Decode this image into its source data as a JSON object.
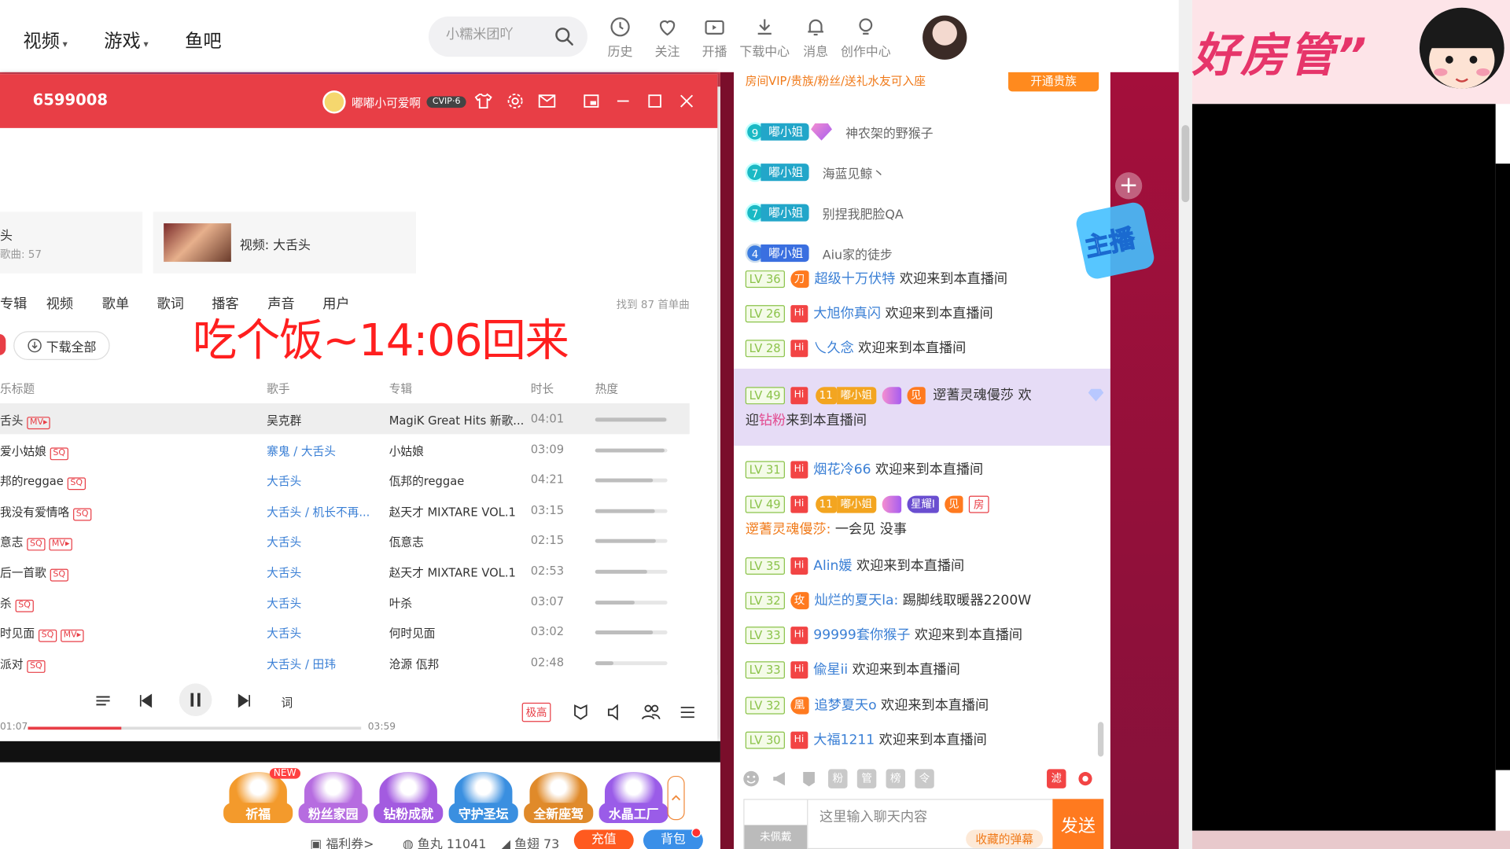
{
  "nav": {
    "links": [
      {
        "label": "视频",
        "caret": "▾"
      },
      {
        "label": "游戏",
        "caret": "▾"
      },
      {
        "label": "鱼吧",
        "caret": ""
      }
    ],
    "search_placeholder": "小糯米团吖",
    "tools": [
      "历史",
      "关注",
      "开播",
      "下载中心",
      "消息",
      "创作中心"
    ]
  },
  "music": {
    "room_id": "6599008",
    "user_name": "嘟嘟小可爱啊",
    "vip": "CVIP·6",
    "card_a": {
      "title": "头",
      "sub": "歌曲: 57"
    },
    "card_b": {
      "title": "视频: 大舌头"
    },
    "tabs": [
      "专辑",
      "视频",
      "歌单",
      "歌词",
      "播客",
      "声音",
      "用户"
    ],
    "found": "找到 87 首单曲",
    "away_msg": "吃个饭~14:06回来",
    "download_all": "下载全部",
    "columns": [
      "乐标题",
      "歌手",
      "专辑",
      "时长",
      "热度"
    ],
    "rows": [
      {
        "title": "舌头",
        "badges": [
          "MV▸"
        ],
        "artist": "吴克群",
        "artist_plain": true,
        "album": "MagiK Great Hits 新歌...",
        "duration": "04:01",
        "heat": 0.98
      },
      {
        "title": "爱小姑娘",
        "badges": [
          "SQ"
        ],
        "artist": "寨鬼 / 大舌头",
        "artist_plain": false,
        "album": "小姑娘",
        "duration": "03:09",
        "heat": 0.96
      },
      {
        "title": "邦的reggae",
        "badges": [
          "SQ"
        ],
        "artist": "大舌头",
        "artist_plain": false,
        "album": "佤邦的reggae",
        "duration": "04:21",
        "heat": 0.8
      },
      {
        "title": "我没有爱情咯",
        "badges": [
          "SQ"
        ],
        "artist": "大舌头 / 机长不再...",
        "artist_plain": false,
        "album": "赵天才 MIXTARE VOL.1",
        "duration": "03:15",
        "heat": 0.82
      },
      {
        "title": "意志",
        "badges": [
          "SQ",
          "MV▸"
        ],
        "artist": "大舌头",
        "artist_plain": false,
        "album": "佤意志",
        "duration": "02:15",
        "heat": 0.84
      },
      {
        "title": "后一首歌",
        "badges": [
          "SQ"
        ],
        "artist": "大舌头",
        "artist_plain": false,
        "album": "赵天才 MIXTARE VOL.1",
        "duration": "02:53",
        "heat": 0.72
      },
      {
        "title": "杀",
        "badges": [
          "SQ"
        ],
        "artist": "大舌头",
        "artist_plain": false,
        "album": "叶杀",
        "duration": "03:07",
        "heat": 0.55
      },
      {
        "title": "时见面",
        "badges": [
          "SQ",
          "MV▸"
        ],
        "artist": "大舌头",
        "artist_plain": false,
        "album": "何时见面",
        "duration": "03:02",
        "heat": 0.8
      },
      {
        "title": "派对",
        "badges": [
          "SQ"
        ],
        "artist": "大舌头 / 田玮",
        "artist_plain": false,
        "album": "沧源 佤邦",
        "duration": "02:48",
        "heat": 0.25
      }
    ],
    "lyric": "词",
    "time_current": "01:07",
    "time_total": "03:59",
    "progress": 0.28,
    "quality": "极高"
  },
  "gifts": {
    "new_tag": "NEW",
    "items": [
      {
        "label": "祈福",
        "color": "#f39a2c"
      },
      {
        "label": "粉丝家园",
        "color": "#b66ce0"
      },
      {
        "label": "钻粉成就",
        "color": "#a35be0"
      },
      {
        "label": "守护圣坛",
        "color": "#3a8fe0"
      },
      {
        "label": "全新座驾",
        "color": "#e08a2a"
      },
      {
        "label": "水晶工厂",
        "color": "#9a5ce8"
      }
    ],
    "welfare": "福利券>",
    "fish_ball": "鱼丸 11041",
    "fish_fin": "鱼翅 73",
    "recharge": "充值",
    "backpack": "背包"
  },
  "chat": {
    "top_line": "房间VIP/贵族/粉丝/送礼水友可入座",
    "open_noble": "开通贵族",
    "fans": [
      {
        "level": "9",
        "badge": "嘟小姐",
        "diamond": true,
        "name": "神农架的野猴子",
        "blue": false
      },
      {
        "level": "7",
        "badge": "嘟小姐",
        "diamond": false,
        "name": "海蓝见鲸丶",
        "blue": false
      },
      {
        "level": "7",
        "badge": "嘟小姐",
        "diamond": false,
        "name": "别捏我肥脸QA",
        "blue": false
      },
      {
        "level": "4",
        "badge": "嘟小姐",
        "diamond": false,
        "name": "Aiu家的徒步",
        "blue": true
      }
    ],
    "messages": [
      {
        "lv": "LV 36",
        "medal": "刀",
        "user": "超级十万伏特",
        "text": "欢迎来到本直播间"
      },
      {
        "lv": "LV 26",
        "medal": "",
        "user": "大旭你真闪",
        "text": "欢迎来到本直播间"
      },
      {
        "lv": "LV 28",
        "medal": "",
        "user": "乀久念",
        "text": "欢迎来到本直播间"
      },
      {
        "lv": "LV 31",
        "medal": "",
        "user": "烟花冷66",
        "text": "欢迎来到本直播间"
      },
      {
        "lv": "LV 35",
        "medal": "",
        "user": "Alin媛",
        "text": "欢迎来到本直播间"
      },
      {
        "lv": "LV 32",
        "medal": "玫",
        "user": "灿烂的夏天la:",
        "text": "踢脚线取暖器2200W"
      },
      {
        "lv": "LV 33",
        "medal": "",
        "user": "99999套你猴子",
        "text": "欢迎来到本直播间"
      },
      {
        "lv": "LV 33",
        "medal": "",
        "user": "偸星ii",
        "text": "欢迎来到本直播间"
      },
      {
        "lv": "LV 32",
        "medal": "凰",
        "user": "追梦夏天o",
        "text": "欢迎来到本直播间"
      },
      {
        "lv": "LV 30",
        "medal": "",
        "user": "大福1211",
        "text": "欢迎来到本直播间"
      }
    ],
    "highlight": {
      "lv": "LV 49",
      "fan_level": "11",
      "badge": "嘟小姐",
      "medal": "见",
      "user": "遻蓍灵魂僈莎",
      "text_a": "欢",
      "text_b": "迎",
      "pink": "钻粉",
      "text_c": "来到本直播间"
    },
    "lv49": {
      "lv": "LV 49",
      "fan_level": "11",
      "badge": "嘟小姐",
      "star": "星耀Ⅰ",
      "medal": "见",
      "room": "房",
      "user": "遻蓍灵魂僈莎:",
      "text": "一会见 没事"
    },
    "tool_icons": [
      "粉",
      "管",
      "榜",
      "令"
    ],
    "not_worn": "未佩戴",
    "input_placeholder": "这里输入聊天内容",
    "fav_danmu": "收藏的弹幕",
    "send": "发送",
    "filter": "滤"
  },
  "sidebar_badge": "主播",
  "banner": {
    "text": "好房管”"
  }
}
